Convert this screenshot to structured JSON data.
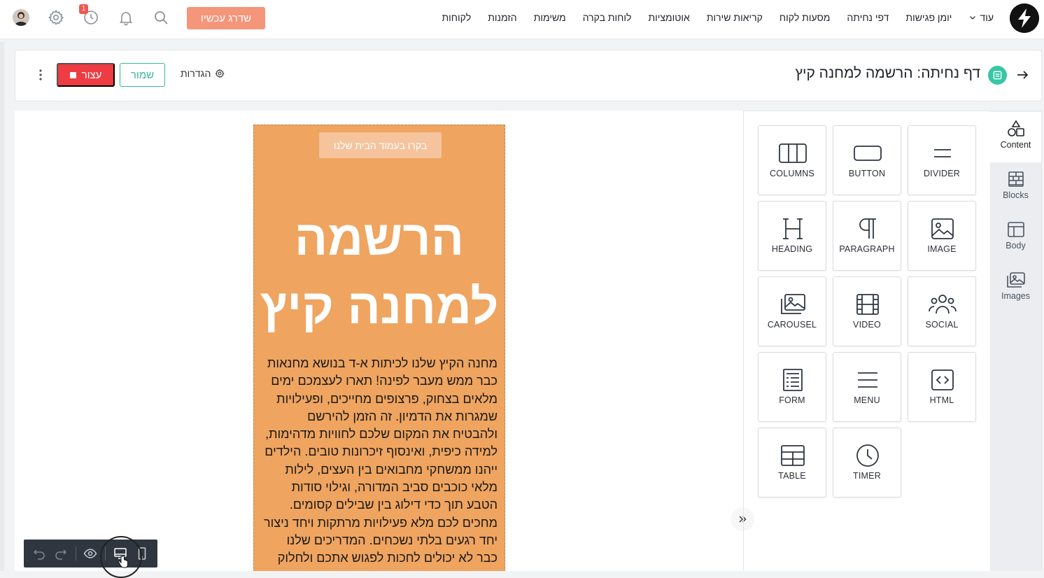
{
  "nav": {
    "items": [
      "לקוחות",
      "הזמנות",
      "משימות",
      "לוחות בקרה",
      "אוטומציות",
      "קריאות שירות",
      "מסעות לקוח",
      "דפי נחיתה",
      "יומן פגישות"
    ],
    "more_label": "עוד",
    "upgrade_label": "שדרג עכשיו",
    "history_badge": "1"
  },
  "header": {
    "title": "דף נחיתה: הרשמה למחנה קיץ",
    "settings_label": "הגדרות",
    "save_label": "שמור",
    "stop_label": "עצור"
  },
  "landing": {
    "home_button": "בקרו בעמוד הבית שלנו",
    "title": "הרשמה למחנה קיץ",
    "body_lines": [
      "מחנה הקיץ שלנו לכיתות א-ד בנושא מחנאות",
      "כבר ממש מעבר לפינה! תארו לעצמכם ימים",
      "מלאים בצחוק, פרצופים מחייכים, ופעילויות",
      "שמגרות את הדמיון. זה הזמן להירשם",
      "ולהבטיח את המקום שלכם לחוויות מדהימות,",
      "למידה כיפית, ואינסוף זיכרונות טובים. הילדים",
      "ייהנו ממשחקי מחבואים בין העצים, לילות",
      "מלאי כוכבים סביב המדורה, וגילוי סודות",
      "הטבע תוך כדי דילוג בין שבילים קסומים.",
      "מחכים לכם מלא פעילויות מרתקות ויחד ניצור",
      "יחד רגעים בלתי נשכחים. המדריכים שלנו",
      "כבר לא יכולים לחכות לפגוש אתכם ולחלוק"
    ],
    "colors": {
      "background": "#efa45f",
      "button": "#f5c49d",
      "text": "#1a1a1a"
    }
  },
  "tools": [
    {
      "label": "COLUMNS",
      "icon": "columns-icon"
    },
    {
      "label": "BUTTON",
      "icon": "button-icon"
    },
    {
      "label": "DIVIDER",
      "icon": "divider-icon"
    },
    {
      "label": "HEADING",
      "icon": "heading-icon"
    },
    {
      "label": "PARAGRAPH",
      "icon": "paragraph-icon"
    },
    {
      "label": "IMAGE",
      "icon": "image-icon"
    },
    {
      "label": "CAROUSEL",
      "icon": "carousel-icon"
    },
    {
      "label": "VIDEO",
      "icon": "video-icon"
    },
    {
      "label": "SOCIAL",
      "icon": "social-icon"
    },
    {
      "label": "FORM",
      "icon": "form-icon"
    },
    {
      "label": "MENU",
      "icon": "menu-icon"
    },
    {
      "label": "HTML",
      "icon": "html-icon"
    },
    {
      "label": "TABLE",
      "icon": "table-icon"
    },
    {
      "label": "TIMER",
      "icon": "timer-icon"
    }
  ],
  "side_tabs": [
    {
      "label": "Content",
      "icon": "shapes-icon",
      "active": true
    },
    {
      "label": "Blocks",
      "icon": "blocks-icon",
      "active": false
    },
    {
      "label": "Body",
      "icon": "body-layout-icon",
      "active": false
    },
    {
      "label": "Images",
      "icon": "images-icon",
      "active": false
    }
  ],
  "theme": {
    "accent": "#3ab795",
    "danger": "#ef3b42",
    "upgrade": "#f5957a"
  }
}
